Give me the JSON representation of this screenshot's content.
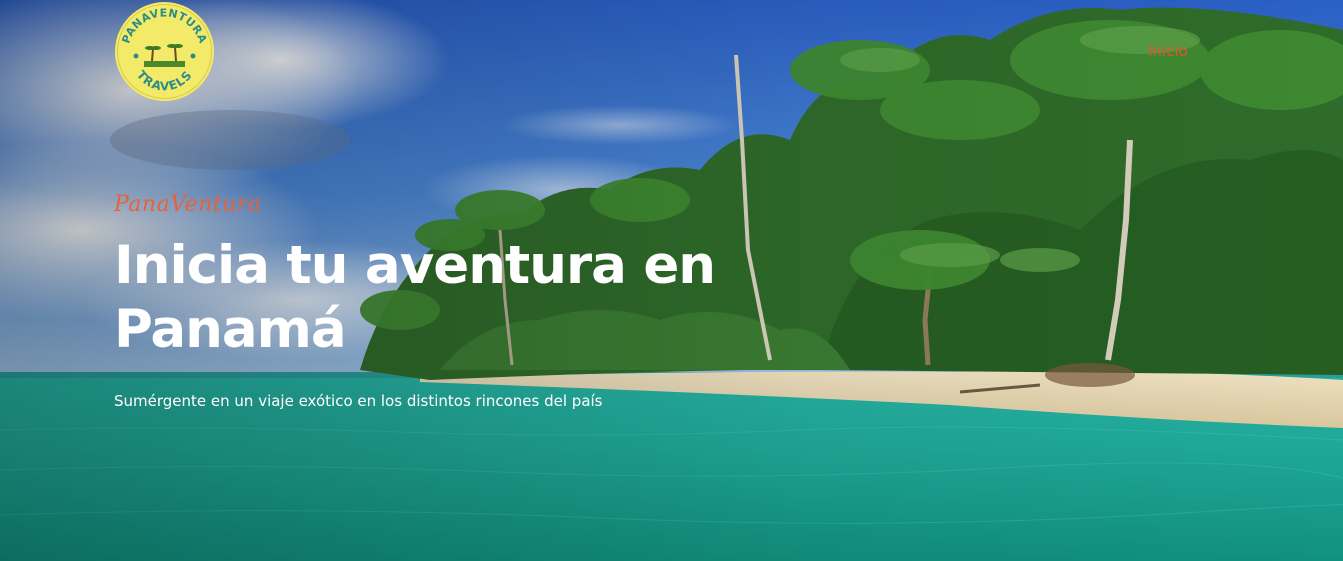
{
  "nav": {
    "home_label": "Inicio"
  },
  "logo": {
    "brand_text": "PANAVENTURA",
    "sub_text": "TRAVELS"
  },
  "hero": {
    "brand_script": "PanaVentura",
    "title": "Inicia tu aventura en Panamá",
    "subtitle": "Sumérgente en un viaje exótico en los distintos rincones del país",
    "background": "tropical-beach-photo"
  },
  "colors": {
    "accent": "#e8512b",
    "logo_yellow": "#f3ea6a",
    "sea": "#1fb8a3",
    "sky": "#2f6fcf"
  }
}
